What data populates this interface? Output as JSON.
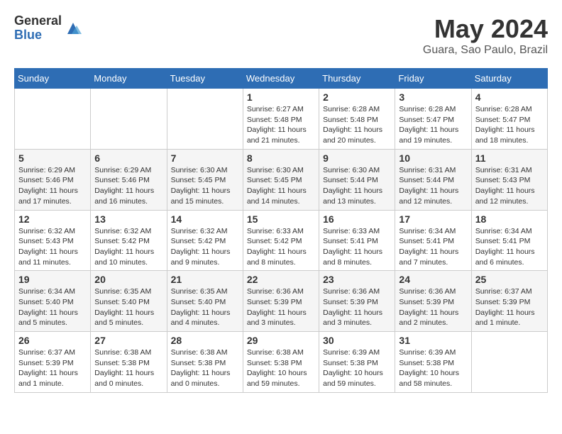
{
  "header": {
    "logo_general": "General",
    "logo_blue": "Blue",
    "month_title": "May 2024",
    "location": "Guara, Sao Paulo, Brazil"
  },
  "days_of_week": [
    "Sunday",
    "Monday",
    "Tuesday",
    "Wednesday",
    "Thursday",
    "Friday",
    "Saturday"
  ],
  "weeks": [
    [
      {
        "day": "",
        "info": ""
      },
      {
        "day": "",
        "info": ""
      },
      {
        "day": "",
        "info": ""
      },
      {
        "day": "1",
        "info": "Sunrise: 6:27 AM\nSunset: 5:48 PM\nDaylight: 11 hours\nand 21 minutes."
      },
      {
        "day": "2",
        "info": "Sunrise: 6:28 AM\nSunset: 5:48 PM\nDaylight: 11 hours\nand 20 minutes."
      },
      {
        "day": "3",
        "info": "Sunrise: 6:28 AM\nSunset: 5:47 PM\nDaylight: 11 hours\nand 19 minutes."
      },
      {
        "day": "4",
        "info": "Sunrise: 6:28 AM\nSunset: 5:47 PM\nDaylight: 11 hours\nand 18 minutes."
      }
    ],
    [
      {
        "day": "5",
        "info": "Sunrise: 6:29 AM\nSunset: 5:46 PM\nDaylight: 11 hours\nand 17 minutes."
      },
      {
        "day": "6",
        "info": "Sunrise: 6:29 AM\nSunset: 5:46 PM\nDaylight: 11 hours\nand 16 minutes."
      },
      {
        "day": "7",
        "info": "Sunrise: 6:30 AM\nSunset: 5:45 PM\nDaylight: 11 hours\nand 15 minutes."
      },
      {
        "day": "8",
        "info": "Sunrise: 6:30 AM\nSunset: 5:45 PM\nDaylight: 11 hours\nand 14 minutes."
      },
      {
        "day": "9",
        "info": "Sunrise: 6:30 AM\nSunset: 5:44 PM\nDaylight: 11 hours\nand 13 minutes."
      },
      {
        "day": "10",
        "info": "Sunrise: 6:31 AM\nSunset: 5:44 PM\nDaylight: 11 hours\nand 12 minutes."
      },
      {
        "day": "11",
        "info": "Sunrise: 6:31 AM\nSunset: 5:43 PM\nDaylight: 11 hours\nand 12 minutes."
      }
    ],
    [
      {
        "day": "12",
        "info": "Sunrise: 6:32 AM\nSunset: 5:43 PM\nDaylight: 11 hours\nand 11 minutes."
      },
      {
        "day": "13",
        "info": "Sunrise: 6:32 AM\nSunset: 5:42 PM\nDaylight: 11 hours\nand 10 minutes."
      },
      {
        "day": "14",
        "info": "Sunrise: 6:32 AM\nSunset: 5:42 PM\nDaylight: 11 hours\nand 9 minutes."
      },
      {
        "day": "15",
        "info": "Sunrise: 6:33 AM\nSunset: 5:42 PM\nDaylight: 11 hours\nand 8 minutes."
      },
      {
        "day": "16",
        "info": "Sunrise: 6:33 AM\nSunset: 5:41 PM\nDaylight: 11 hours\nand 8 minutes."
      },
      {
        "day": "17",
        "info": "Sunrise: 6:34 AM\nSunset: 5:41 PM\nDaylight: 11 hours\nand 7 minutes."
      },
      {
        "day": "18",
        "info": "Sunrise: 6:34 AM\nSunset: 5:41 PM\nDaylight: 11 hours\nand 6 minutes."
      }
    ],
    [
      {
        "day": "19",
        "info": "Sunrise: 6:34 AM\nSunset: 5:40 PM\nDaylight: 11 hours\nand 5 minutes."
      },
      {
        "day": "20",
        "info": "Sunrise: 6:35 AM\nSunset: 5:40 PM\nDaylight: 11 hours\nand 5 minutes."
      },
      {
        "day": "21",
        "info": "Sunrise: 6:35 AM\nSunset: 5:40 PM\nDaylight: 11 hours\nand 4 minutes."
      },
      {
        "day": "22",
        "info": "Sunrise: 6:36 AM\nSunset: 5:39 PM\nDaylight: 11 hours\nand 3 minutes."
      },
      {
        "day": "23",
        "info": "Sunrise: 6:36 AM\nSunset: 5:39 PM\nDaylight: 11 hours\nand 3 minutes."
      },
      {
        "day": "24",
        "info": "Sunrise: 6:36 AM\nSunset: 5:39 PM\nDaylight: 11 hours\nand 2 minutes."
      },
      {
        "day": "25",
        "info": "Sunrise: 6:37 AM\nSunset: 5:39 PM\nDaylight: 11 hours\nand 1 minute."
      }
    ],
    [
      {
        "day": "26",
        "info": "Sunrise: 6:37 AM\nSunset: 5:39 PM\nDaylight: 11 hours\nand 1 minute."
      },
      {
        "day": "27",
        "info": "Sunrise: 6:38 AM\nSunset: 5:38 PM\nDaylight: 11 hours\nand 0 minutes."
      },
      {
        "day": "28",
        "info": "Sunrise: 6:38 AM\nSunset: 5:38 PM\nDaylight: 11 hours\nand 0 minutes."
      },
      {
        "day": "29",
        "info": "Sunrise: 6:38 AM\nSunset: 5:38 PM\nDaylight: 10 hours\nand 59 minutes."
      },
      {
        "day": "30",
        "info": "Sunrise: 6:39 AM\nSunset: 5:38 PM\nDaylight: 10 hours\nand 59 minutes."
      },
      {
        "day": "31",
        "info": "Sunrise: 6:39 AM\nSunset: 5:38 PM\nDaylight: 10 hours\nand 58 minutes."
      },
      {
        "day": "",
        "info": ""
      }
    ]
  ]
}
